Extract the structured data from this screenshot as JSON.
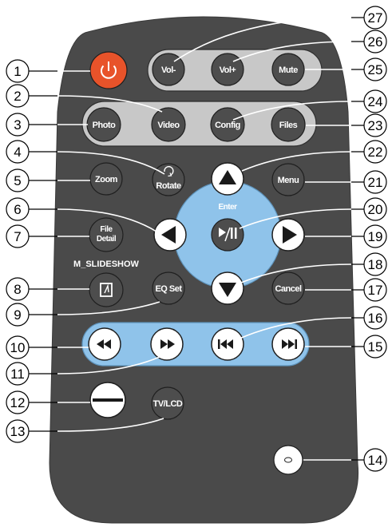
{
  "buttons": {
    "vol_minus": "Vol-",
    "vol_plus": "Vol+",
    "mute": "Mute",
    "photo": "Photo",
    "video": "Video",
    "config": "Config",
    "files": "Files",
    "zoom": "Zoom",
    "rotate": "Rotate",
    "menu": "Menu",
    "enter": "Enter",
    "file_detail_line1": "File",
    "file_detail_line2": "Detail",
    "m_slideshow": "M_SLIDESHOW",
    "eq_set": "EQ Set",
    "cancel": "Cancel",
    "tv_lcd": "TV/LCD"
  },
  "callouts": [
    "1",
    "2",
    "3",
    "4",
    "5",
    "6",
    "7",
    "8",
    "9",
    "10",
    "11",
    "12",
    "13",
    "14",
    "15",
    "16",
    "17",
    "18",
    "19",
    "20",
    "21",
    "22",
    "23",
    "24",
    "25",
    "26",
    "27"
  ],
  "colors": {
    "remote_body": "#4a4a4a",
    "power": "#e8532a",
    "button": "#4d4d4d",
    "pill_gray": "#c8c8c8",
    "pill_blue": "#8fc3ea"
  }
}
